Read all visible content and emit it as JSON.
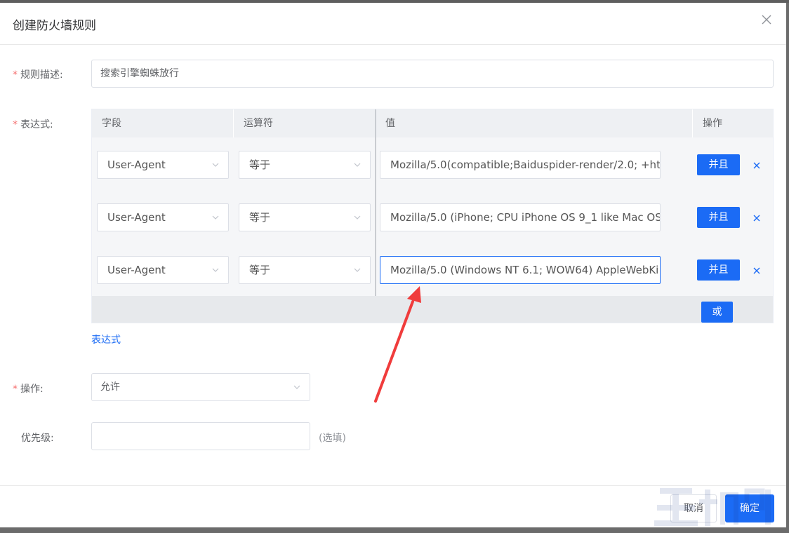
{
  "dialog": {
    "title": "创建防火墙规则"
  },
  "form": {
    "description": {
      "label": "规则描述:",
      "value": "搜索引擎蜘蛛放行"
    },
    "expression": {
      "label": "表达式:"
    },
    "action": {
      "label": "操作:",
      "value": "允许"
    },
    "priority": {
      "label": "优先级:",
      "value": "",
      "hint": "(选填)"
    }
  },
  "table": {
    "headers": [
      "字段",
      "运算符",
      "值",
      "操作"
    ],
    "rows": [
      {
        "field": "User-Agent",
        "operator": "等于",
        "value": "Mozilla/5.0(compatible;Baiduspider-render/2.0; +htt",
        "and_label": "并且"
      },
      {
        "field": "User-Agent",
        "operator": "等于",
        "value": "Mozilla/5.0 (iPhone; CPU iPhone OS 9_1 like Mac OS",
        "and_label": "并且"
      },
      {
        "field": "User-Agent",
        "operator": "等于",
        "value": "Mozilla/5.0 (Windows NT 6.1; WOW64) AppleWebKi",
        "and_label": "并且"
      }
    ],
    "or_label": "或",
    "expression_link": "表达式"
  },
  "footer": {
    "cancel_label": "取消",
    "ok_label": "确定"
  },
  "colors": {
    "primary": "#1b6bf5",
    "required": "#f56c6c",
    "annotation_arrow": "#f03c3c"
  },
  "icons": {
    "close": "close-icon",
    "select": "chevron-down-icon",
    "remove": "remove-icon"
  }
}
